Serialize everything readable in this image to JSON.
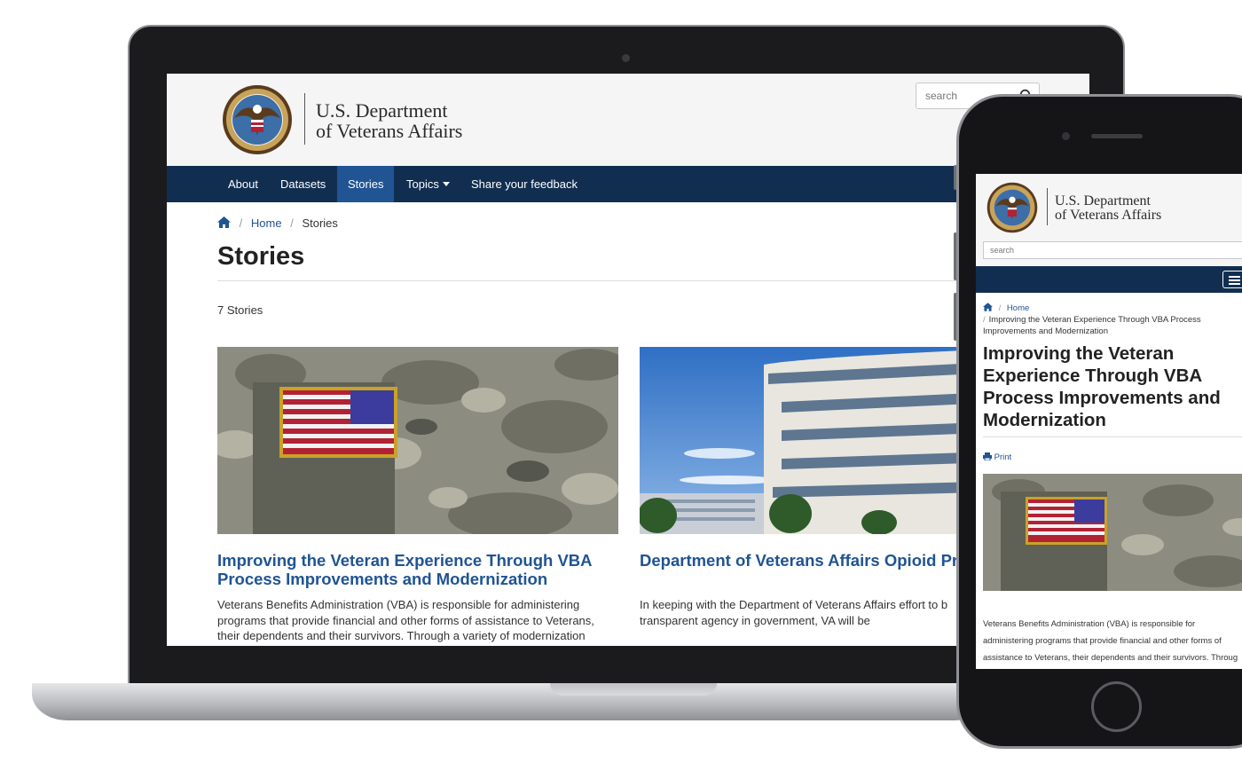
{
  "site": {
    "brand_line1": "U.S. Department",
    "brand_line2": "of Veterans Affairs",
    "search_placeholder": "search"
  },
  "nav": {
    "items": [
      {
        "label": "About"
      },
      {
        "label": "Datasets"
      },
      {
        "label": "Stories",
        "active": true
      },
      {
        "label": "Topics"
      },
      {
        "label": "Share your feedback"
      }
    ]
  },
  "breadcrumb": {
    "home": "Home",
    "current": "Stories"
  },
  "page": {
    "title": "Stories",
    "count": "7 Stories"
  },
  "cards": [
    {
      "title": "Improving the Veteran Experience Through VBA Process Improvements and Modernization",
      "body": "Veterans Benefits Administration (VBA) is responsible for administering programs that provide financial and other forms of assistance to Veterans, their dependents and their survivors. Through a variety of modernization"
    },
    {
      "title": "Department of Veterans Affairs Opioid Pr Data",
      "body": "In keeping with the Department of Veterans Affairs effort to b transparent agency in government, VA will be"
    }
  ],
  "mobile": {
    "search_placeholder": "search",
    "crumb_home": "Home",
    "crumb_current": "Improving the Veteran Experience Through VBA Process Improvements and Modernization",
    "title": "Improving the Veteran Experience Through VBA Process Improvements and Modernization",
    "print_label": "Print",
    "body_lines": [
      "Veterans Benefits Administration (VBA) is responsible for",
      "administering programs that provide financial and other forms of",
      "assistance to Veterans, their dependents and their survivors. Throug"
    ]
  },
  "colors": {
    "nav_bg": "#112e51",
    "nav_active": "#205493",
    "link": "#205493"
  }
}
